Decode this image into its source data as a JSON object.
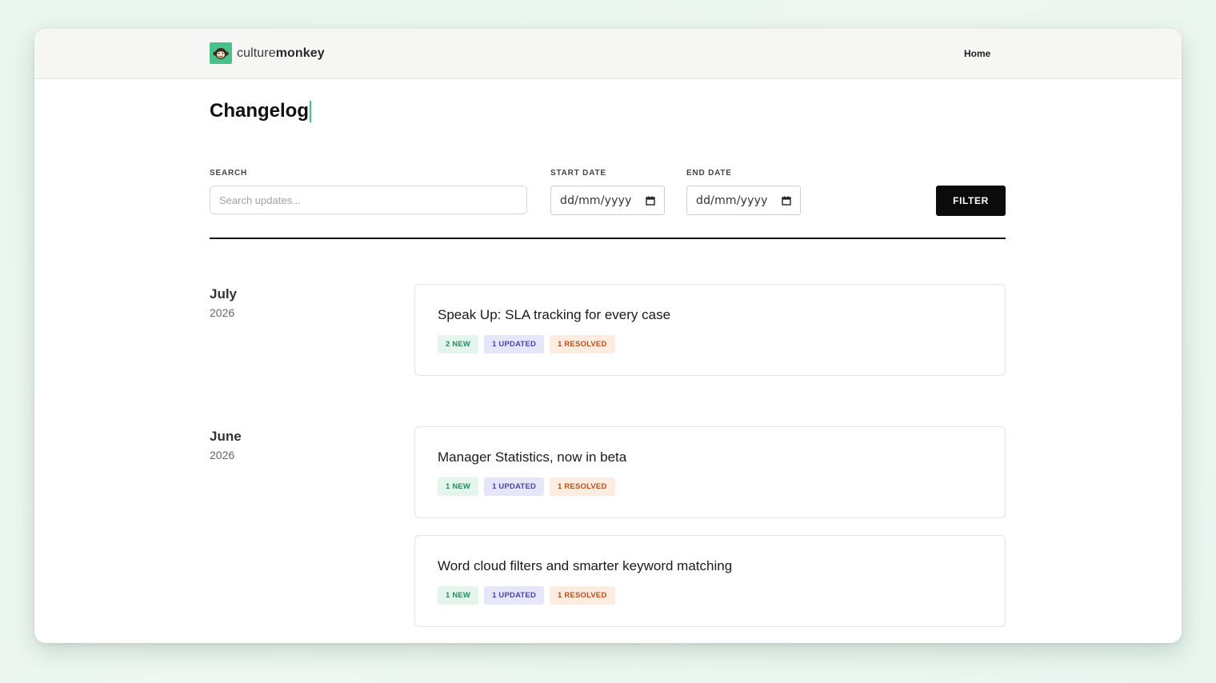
{
  "header": {
    "logo_light": "culture",
    "logo_bold": "monkey",
    "nav_home": "Home"
  },
  "page": {
    "title": "Changelog"
  },
  "filters": {
    "search_label": "SEARCH",
    "search_placeholder": "Search updates...",
    "start_label": "START DATE",
    "start_value": "dd/mm/yyyy",
    "end_label": "END DATE",
    "end_value": "dd/mm/yyyy",
    "filter_button": "FILTER"
  },
  "groups": [
    {
      "month": "July",
      "year": "2026",
      "entries": [
        {
          "title": "Speak Up: SLA tracking for every case",
          "new": "2 NEW",
          "updated": "1 UPDATED",
          "resolved": "1 RESOLVED"
        }
      ]
    },
    {
      "month": "June",
      "year": "2026",
      "entries": [
        {
          "title": "Manager Statistics, now in beta",
          "new": "1 NEW",
          "updated": "1 UPDATED",
          "resolved": "1 RESOLVED"
        },
        {
          "title": "Word cloud filters and smarter keyword matching",
          "new": "1 NEW",
          "updated": "1 UPDATED",
          "resolved": "1 RESOLVED"
        }
      ]
    }
  ],
  "colors": {
    "brand": "#48c28a",
    "badge_new": "#2a8a5c",
    "badge_updated": "#4a44a8",
    "badge_resolved": "#b8501e"
  }
}
